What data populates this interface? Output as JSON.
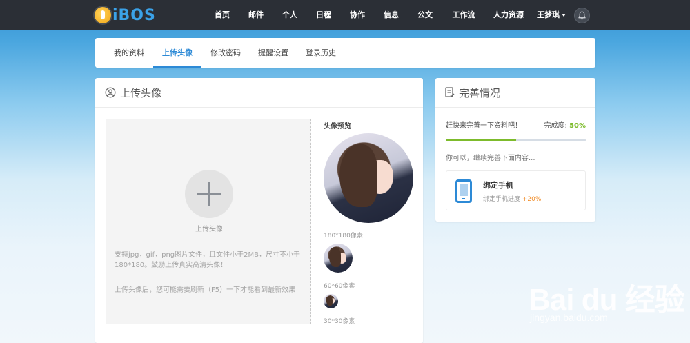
{
  "brand": {
    "logo_text": "iBOS"
  },
  "nav": {
    "items": [
      "首页",
      "邮件",
      "个人",
      "日程",
      "协作",
      "信息",
      "公文",
      "工作流",
      "人力资源"
    ],
    "user_name": "王梦琪"
  },
  "tabs": {
    "items": [
      "我的资料",
      "上传头像",
      "修改密码",
      "提醒设置",
      "登录历史"
    ],
    "active": "上传头像"
  },
  "upload": {
    "title": "上传头像",
    "dropzone_label": "上传头像",
    "help_text": "支持jpg，gif，png图片文件，且文件小于2MB，尺寸不小于180*180。鼓励上传真实高清头像！",
    "note_text": "上传头像后，您可能需要刷新（F5）一下才能看到最新效果",
    "preview_title": "头像预览",
    "sizes": [
      "180*180像素",
      "60*60像素",
      "30*30像素"
    ]
  },
  "completion": {
    "title": "完善情况",
    "prompt": "赶快来完善一下资料吧！",
    "percent_label": "完成度:",
    "percent_value": "50%",
    "progress": 0.5,
    "hint": "你可以，继续完善下面内容...",
    "task": {
      "title": "绑定手机",
      "sub_label": "绑定手机进度",
      "bonus": "+20%"
    }
  },
  "watermark": {
    "brand": "Bai du 经验",
    "url": "jingyan.baidu.com"
  },
  "colors": {
    "accent": "#2d8ad6",
    "success": "#7dbb2c",
    "bonus": "#f08a24",
    "topbar": "#2b2f36"
  }
}
